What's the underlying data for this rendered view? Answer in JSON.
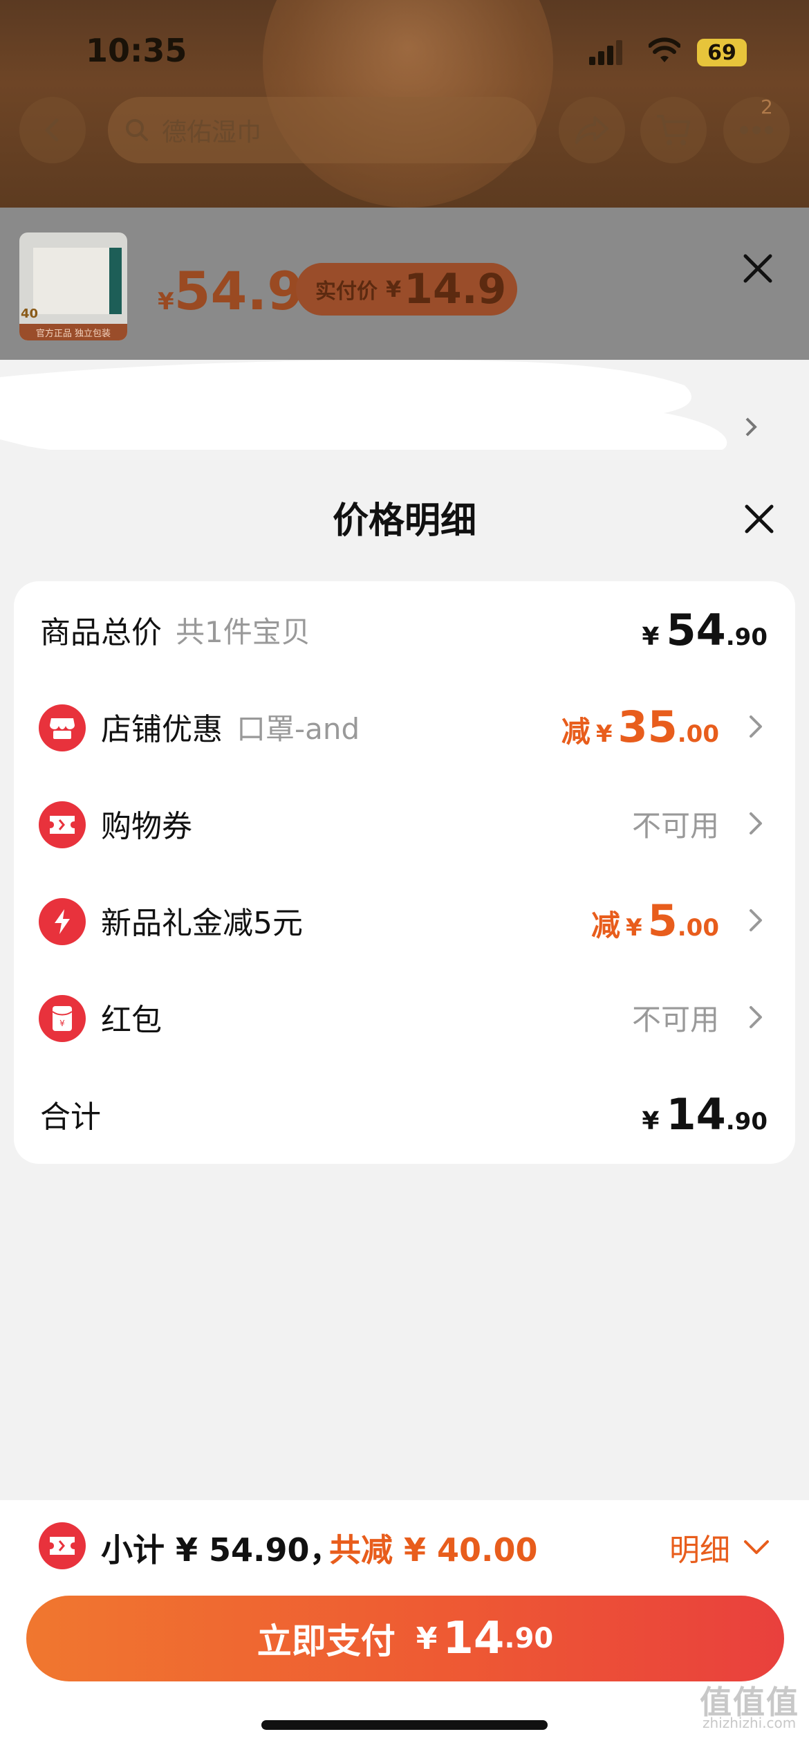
{
  "status_bar": {
    "time": "10:35",
    "battery": "69"
  },
  "nav": {
    "search_placeholder": "德佑湿巾",
    "cart_badge": "2"
  },
  "product": {
    "price_yen": "¥",
    "price": "54.9",
    "real_price_label": "实付价",
    "real_price_yen": "¥",
    "real_price": "14.9",
    "thumb_tag": "官方正品 独立包装",
    "thumb_count": "40"
  },
  "sheet": {
    "title": "价格明细",
    "rows": [
      {
        "label": "商品总价",
        "sub": "共1件宝贝",
        "yen": "¥",
        "int": "54",
        "dec": ".90"
      },
      {
        "label": "店铺优惠",
        "sub": "口罩-and",
        "prefix": "减",
        "yen": "¥",
        "int": "35",
        "dec": ".00"
      },
      {
        "label": "购物券",
        "status": "不可用"
      },
      {
        "label": "新品礼金减5元",
        "prefix": "减",
        "yen": "¥",
        "int": "5",
        "dec": ".00"
      },
      {
        "label": "红包",
        "status": "不可用"
      },
      {
        "label": "合计",
        "yen": "¥",
        "int": "14",
        "dec": ".90"
      }
    ]
  },
  "bottom": {
    "subtotal": "小计 ¥ 54.90，",
    "total_off": "共减 ¥ 40.00",
    "detail": "明细",
    "pay_label": "立即支付",
    "pay_yen": "¥",
    "pay_int": "14",
    "pay_dec": ".90"
  },
  "watermark": {
    "text": "值值值",
    "sub": "zhizhizhi.com"
  },
  "colors": {
    "accent": "#e85d1c",
    "icon_red": "#e8323c",
    "pay_start": "#f0772f",
    "pay_end": "#e9403d"
  }
}
